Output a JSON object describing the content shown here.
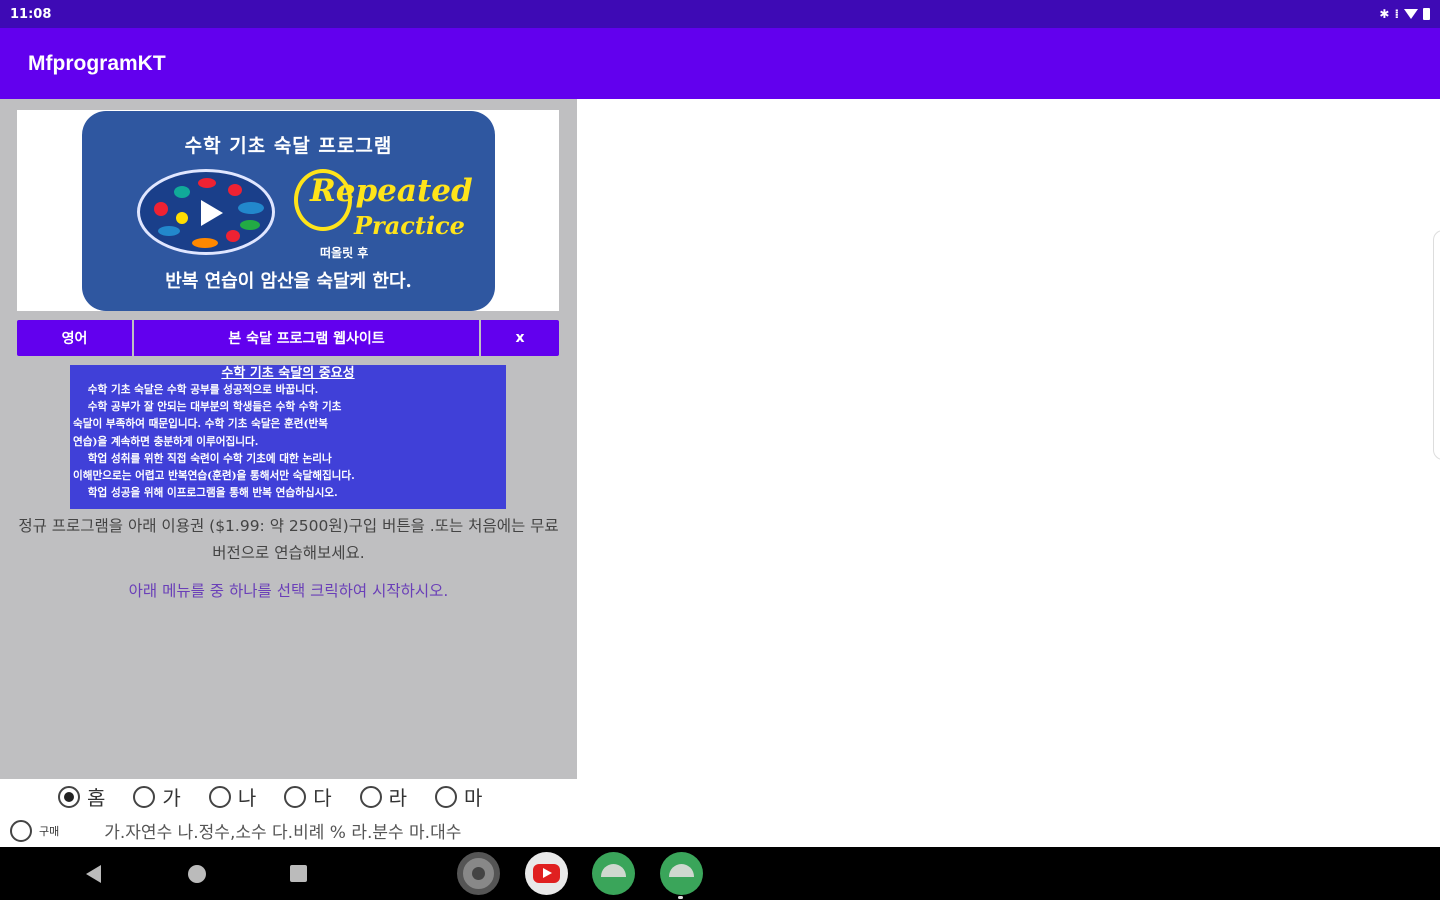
{
  "status_bar": {
    "time": "11:08",
    "icons": [
      "bluetooth-icon",
      "vibrate-icon",
      "wifi-icon",
      "battery-icon"
    ]
  },
  "app_bar": {
    "title": "MfprogramKT"
  },
  "banner": {
    "title": "수학 기초 숙달 프로그램",
    "logo_line1": "Repeated",
    "logo_line2": "Practice",
    "small_text": "떠올릿 후",
    "bottom_text": "반복 연습이 암산을 숙달케 한다."
  },
  "buttons": {
    "english": "영어",
    "website": "본 숙달 프로그램 웹사이트",
    "close": "x"
  },
  "info_box": {
    "title": "수학 기초 숙달의 중요성",
    "body": "    수학 기초 숙달은 수학 공부를 성공적으로 바꿉니다.\n    수학 공부가 잘 안되는 대부분의 학생들은 수학 수학 기초\n숙달이 부족하여 때문입니다. 수학 기초 숙달은 훈련(반복\n연습)을 계속하면 충분하게 이루어집니다.\n    학업 성취를 위한 직접 숙련이 수학 기초에 대한 논리나\n이해만으로는 어렵고 반복연습(훈련)을 통해서만 숙달해집니다.\n    학업 성공을 위해 이프로그램을 통해 반복 연습하십시오."
  },
  "description": "정규 프로그램을 아래 이용권 ($1.99: 약 2500원)구입 버튼을 .또는 처음에는 무료 버전으로 연습해보세요.",
  "hint": "아래 메뉴를 중 하나를 선택 크릭하여 시작하시오.",
  "radio_options": [
    {
      "label": "홈",
      "checked": true
    },
    {
      "label": "가",
      "checked": false
    },
    {
      "label": "나",
      "checked": false
    },
    {
      "label": "다",
      "checked": false
    },
    {
      "label": "라",
      "checked": false
    },
    {
      "label": "마",
      "checked": false
    }
  ],
  "buy_option": {
    "label": "구매",
    "checked": false
  },
  "menu_legend": "가.자연수 나.정수,소수 다.비례 % 라.분수 마.대수",
  "dock": [
    "settings-icon",
    "youtube-icon",
    "app-icon",
    "app-icon"
  ],
  "colors": {
    "status_bar": "#3e0ab5",
    "app_bar": "#6200ee",
    "panel": "#bfbfc1",
    "info_box": "#4040d8",
    "logo_yellow": "#ffe41a"
  }
}
